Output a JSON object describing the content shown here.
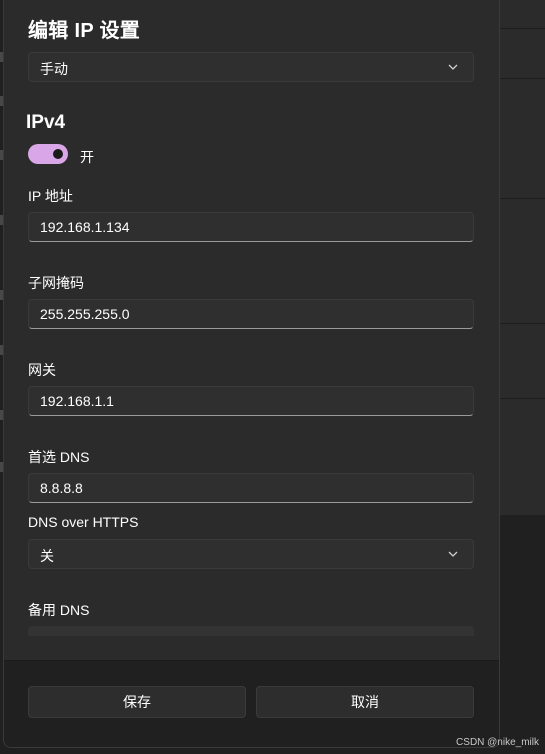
{
  "dialog": {
    "title": "编辑 IP 设置",
    "mode_select": {
      "value": "手动"
    }
  },
  "ipv4": {
    "heading": "IPv4",
    "toggle": {
      "state": "on",
      "label": "开",
      "color": "#d9a6e8"
    },
    "ip_address": {
      "label": "IP 地址",
      "value": "192.168.1.134"
    },
    "subnet_mask": {
      "label": "子网掩码",
      "value": "255.255.255.0"
    },
    "gateway": {
      "label": "网关",
      "value": "192.168.1.1"
    },
    "preferred_dns": {
      "label": "首选 DNS",
      "value": "8.8.8.8"
    },
    "dns_over_https": {
      "label": "DNS over HTTPS",
      "value": "关"
    },
    "alternate_dns": {
      "label": "备用 DNS",
      "value": ""
    }
  },
  "footer": {
    "save_label": "保存",
    "cancel_label": "取消"
  },
  "watermark": "CSDN @nike_milk"
}
